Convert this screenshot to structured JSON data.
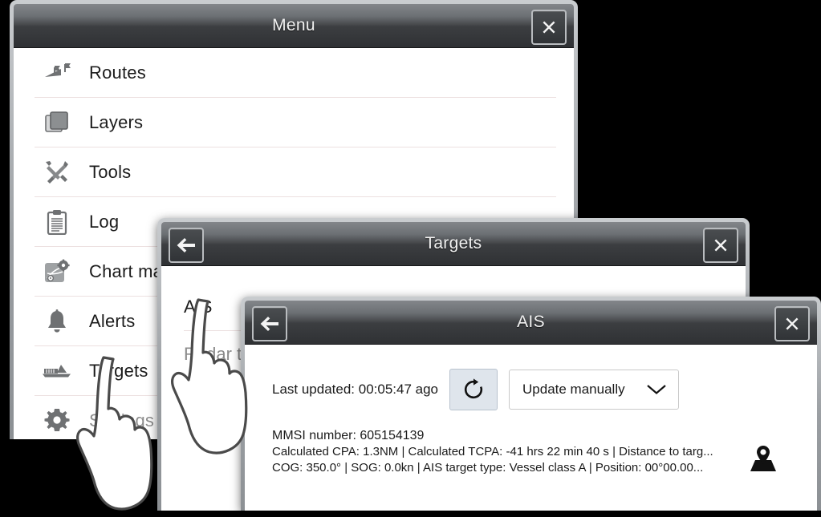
{
  "menu": {
    "title": "Menu",
    "close_icon": "close-icon",
    "items": [
      {
        "label": "Routes",
        "icon": "route-flags-icon",
        "dim": false
      },
      {
        "label": "Layers",
        "icon": "layers-icon",
        "dim": false
      },
      {
        "label": "Tools",
        "icon": "tools-icon",
        "dim": false
      },
      {
        "label": "Log",
        "icon": "clipboard-log-icon",
        "dim": false
      },
      {
        "label": "Chart ma",
        "icon": "chart-manager-icon",
        "dim": false
      },
      {
        "label": "Alerts",
        "icon": "bell-icon",
        "dim": false
      },
      {
        "label": "Targets",
        "icon": "vessel-icon",
        "dim": false
      },
      {
        "label": "Settings",
        "icon": "gear-icon",
        "dim": true
      }
    ]
  },
  "targets": {
    "title": "Targets",
    "back_icon": "back-arrow-icon",
    "close_icon": "close-icon",
    "items": [
      {
        "label": "AIS",
        "dim": false
      },
      {
        "label": "Radar ta",
        "dim": true
      }
    ]
  },
  "ais": {
    "title": "AIS",
    "back_icon": "back-arrow-icon",
    "close_icon": "close-icon",
    "last_updated": "Last updated: 00:05:47 ago",
    "refresh_icon": "refresh-icon",
    "update_mode": "Update manually",
    "chevron_icon": "chevron-down-icon",
    "pin_icon": "map-pin-icon",
    "details": [
      "MMSI number: 605154139",
      "Calculated CPA: 1.3NM | Calculated TCPA: -41 hrs 22 min 40 s | Distance to targ...",
      "COG: 350.0° | SOG: 0.0kn | AIS target type: Vessel class A | Position: 00°00.00..."
    ]
  },
  "colors": {
    "titlebar_dark": "#2f3134",
    "titlebar_light": "#83868a",
    "separator": "#ece0e0",
    "refresh_fill": "#dfe5ec",
    "background": "#000000"
  }
}
